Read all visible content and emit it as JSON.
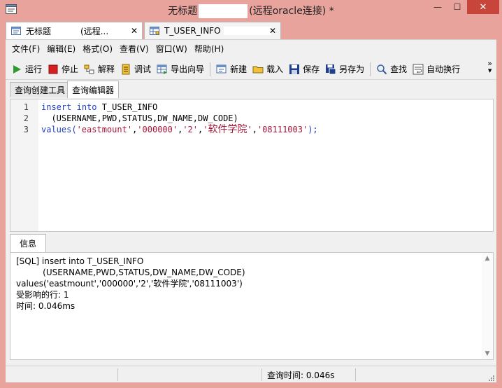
{
  "window": {
    "title_prefix": "无标题",
    "title_suffix": "(远程oracle连接) *",
    "minimize": "—",
    "maximize": "☐",
    "close": "✕"
  },
  "doc_tabs": [
    {
      "label": "无标题",
      "sub": "(远程...",
      "close": "✕",
      "icon": "query-icon"
    },
    {
      "label": "T_USER_INFO",
      "close": "✕",
      "icon": "table-icon"
    }
  ],
  "menu": [
    "文件(F)",
    "编辑(E)",
    "格式(O)",
    "查看(V)",
    "窗口(W)",
    "帮助(H)"
  ],
  "toolbar": {
    "run": "运行",
    "stop": "停止",
    "explain": "解释",
    "debug": "调试",
    "export_wizard": "导出向导",
    "new": "新建",
    "load": "载入",
    "save": "保存",
    "save_as": "另存为",
    "find": "查找",
    "word_wrap": "自动换行",
    "more": "»"
  },
  "sub_tabs": [
    "查询创建工具",
    "查询编辑器"
  ],
  "editor": {
    "line_numbers": [
      "1",
      "2",
      "3"
    ],
    "line1": {
      "kw1": "insert",
      "kw2": "into",
      "rest": " T_USER_INFO"
    },
    "line2": "  (USERNAME,PWD,STATUS,DW_NAME,DW_CODE)",
    "line3": {
      "pre": "values(",
      "s1": "'eastmount'",
      "s2": "'000000'",
      "s3": "'2'",
      "s4q1": "'",
      "s4": "软件学院",
      "s4q2": "'",
      "s5": "'08111003'",
      "post": ");"
    }
  },
  "info": {
    "tab": "信息",
    "lines": [
      "[SQL] insert into T_USER_INFO",
      "          (USERNAME,PWD,STATUS,DW_NAME,DW_CODE)",
      "values('eastmount','000000','2','软件学院','08111003')",
      "受影响的行: 1",
      "时间: 0.046ms"
    ]
  },
  "status": {
    "query_time": "查询时间: 0.046s"
  },
  "colors": {
    "frame": "#e7a39c",
    "keyword": "#1f3fbf",
    "string": "#a6173a",
    "close_button": "#c7453b"
  }
}
